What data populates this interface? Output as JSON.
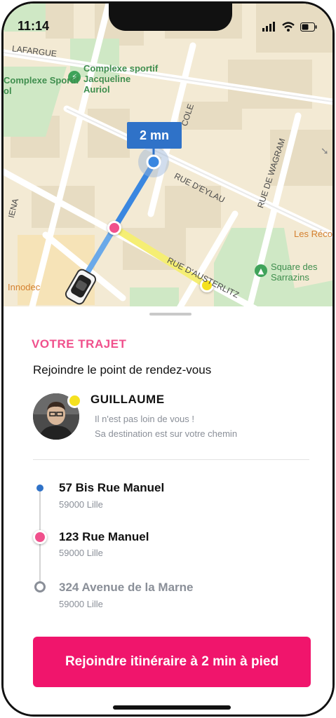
{
  "status_bar": {
    "time": "11:14"
  },
  "map": {
    "eta_label": "2 mn",
    "street_labels": [
      "LAFARGUE",
      "RUE D'EYLAU",
      "RUE DE WAGRAM",
      "RUE D'AUSTERLITZ",
      "COLE",
      "IENA"
    ],
    "poi_labels": {
      "complexe_jacqueline": "Complexe sportif\nJacqueline\nAuriol",
      "complexe_left": "Complexe Sportif\nol",
      "square": "Square des\nSarrazins",
      "innodec": "Innodec",
      "les_reco": "Les Réco"
    }
  },
  "sheet": {
    "section_title": "VOTRE TRAJET",
    "subtitle": "Rejoindre le point de rendez-vous",
    "driver": {
      "name": "GUILLAUME",
      "note_line1": "Il n'est pas loin de vous !",
      "note_line2": "Sa destination est sur votre chemin"
    },
    "stops": [
      {
        "title": "57 Bis Rue Manuel",
        "city": "59000 Lille"
      },
      {
        "title": "123  Rue Manuel",
        "city": "59000 Lille"
      },
      {
        "title": "324 Avenue de la Marne",
        "city": "59000 Lille"
      }
    ],
    "cta_label": "Rejoindre itinéraire à 2 min à pied"
  },
  "colors": {
    "accent_pink": "#f0156c",
    "title_pink": "#f0508c",
    "route_blue": "#2f72c8",
    "driver_yellow": "#f5e11f"
  }
}
